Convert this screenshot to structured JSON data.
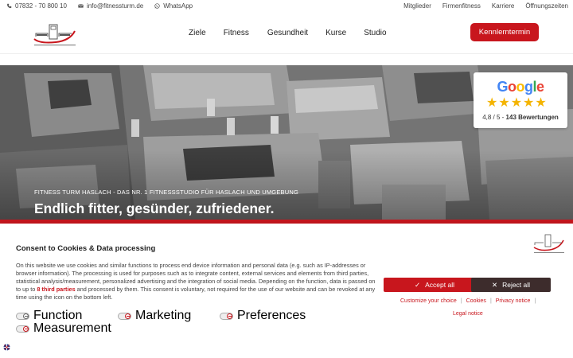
{
  "topbar": {
    "phone": "07832 - 70 800 10",
    "email": "info@fitnessturm.de",
    "whatsapp": "WhatsApp",
    "links": [
      "Mitglieder",
      "Firmenfitness",
      "Karriere",
      "Öffnungszeiten"
    ]
  },
  "nav": {
    "items": [
      "Ziele",
      "Fitness",
      "Gesundheit",
      "Kurse",
      "Studio"
    ],
    "cta": "Kennlerntermin"
  },
  "hero": {
    "subtitle": "FITNESS TURM HASLACH - DAS NR. 1 FITNESSSTUDIO FÜR HASLACH UND UMGEBUNG",
    "headline": "Endlich fitter, gesünder, zufriedener."
  },
  "google_rating": {
    "brand": "Google",
    "stars": 5,
    "score": "4,8 / 5 - ",
    "reviews": "143 Bewertungen"
  },
  "consent": {
    "title": "Consent to Cookies & Data processing",
    "body_before": "On this website we use cookies and similar functions to process end device information and personal data (e.g. such as IP-addresses or browser information). The processing is used for purposes such as to integrate content, external services and elements from third parties, statistical analysis/measurement, personalized advertising and the integration of social media. Depending on the function, data is passed on to up to ",
    "body_link": "8 third parties",
    "body_after": " and processed by them. This consent is voluntary, not required for the use of our website and can be revoked at any time using the icon on the bottom left.",
    "toggles": [
      "Function",
      "Marketing",
      "Preferences",
      "Measurement"
    ],
    "accept": "Accept all",
    "reject": "Reject all",
    "customize": "Customize your choice",
    "cookies": "Cookies",
    "privacy": "Privacy notice",
    "legal": "Legal notice"
  },
  "colors": {
    "brand_red": "#c8161d",
    "reject_dark": "#3d2c2c",
    "star_gold": "#f4b400"
  }
}
